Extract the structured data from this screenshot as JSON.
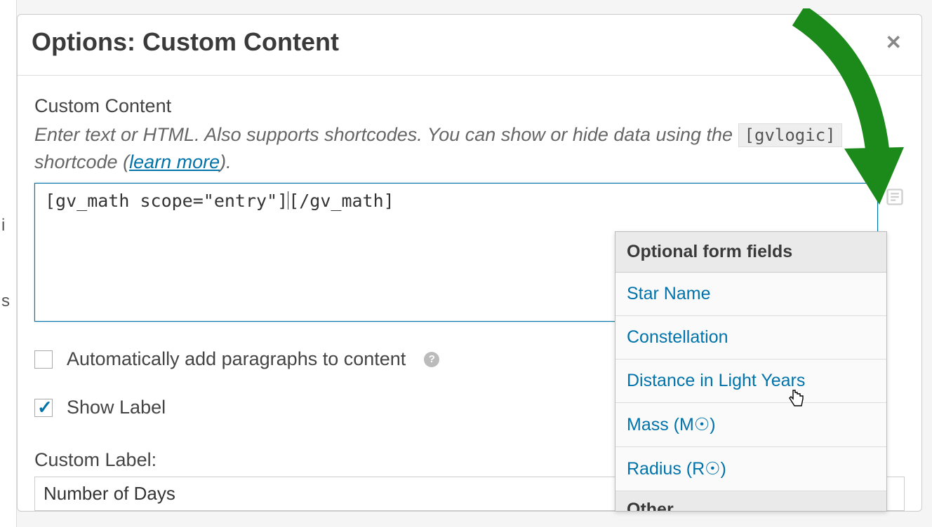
{
  "modal": {
    "title": "Options: Custom Content"
  },
  "content": {
    "label": "Custom Content",
    "help_prefix": "Enter text or HTML. Also supports shortcodes. You can show or hide data using the ",
    "help_code": "[gvlogic]",
    "help_suffix_1": " shortcode (",
    "learn_more": "learn more",
    "help_suffix_2": ").",
    "textarea_prefix": "[gv_math scope=\"entry\"]",
    "textarea_suffix": "[/gv_math]"
  },
  "options": {
    "auto_para": "Automatically add paragraphs to content",
    "show_label": "Show Label"
  },
  "custom_label": {
    "title": "Custom Label:",
    "value": "Number of Days"
  },
  "dropdown": {
    "header": "Optional form fields",
    "items": [
      "Star Name",
      "Constellation",
      "Distance in Light Years",
      "Mass (M☉)",
      "Radius (R☉)"
    ],
    "subheader": "Other"
  }
}
